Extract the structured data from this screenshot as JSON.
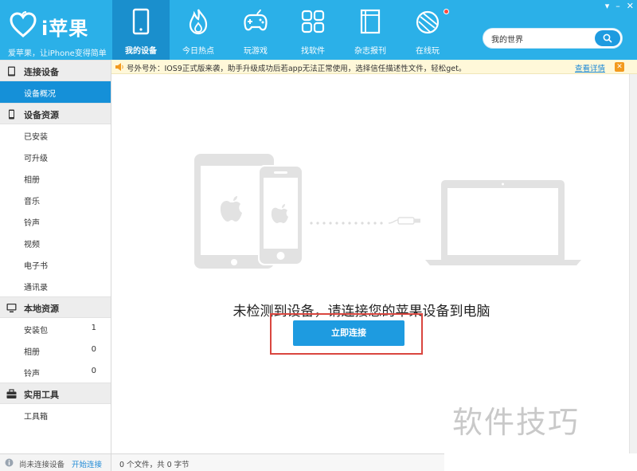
{
  "app": {
    "logo_text": "i苹果",
    "slogan": "爱苹果，让iPhone变得简单"
  },
  "nav": [
    {
      "label": "我的设备",
      "icon": "device-icon",
      "active": true
    },
    {
      "label": "今日热点",
      "icon": "flame-icon"
    },
    {
      "label": "玩游戏",
      "icon": "gamepad-icon"
    },
    {
      "label": "找软件",
      "icon": "apps-grid-icon"
    },
    {
      "label": "杂志报刊",
      "icon": "magazine-icon"
    },
    {
      "label": "在线玩",
      "icon": "online-play-icon",
      "badge": true
    }
  ],
  "window_controls": {
    "menu": "▾",
    "minimize": "–",
    "close": "✕"
  },
  "search": {
    "value": "我的世界"
  },
  "notice": {
    "text": "号外号外：IOS9正式版来袭，助手升级成功后若app无法正常使用，选择信任描述性文件，轻松get。",
    "link": "查看详情",
    "close": "✕"
  },
  "sidebar": {
    "sections": [
      {
        "title": "连接设备",
        "icon": "tablet-icon",
        "items": [
          {
            "label": "设备概况",
            "active": true
          }
        ]
      },
      {
        "title": "设备资源",
        "icon": "phone-icon",
        "items": [
          {
            "label": "已安装"
          },
          {
            "label": "可升级"
          },
          {
            "label": "相册"
          },
          {
            "label": "音乐"
          },
          {
            "label": "铃声"
          },
          {
            "label": "视频"
          },
          {
            "label": "电子书"
          },
          {
            "label": "通讯录"
          }
        ]
      },
      {
        "title": "本地资源",
        "icon": "monitor-icon",
        "items": [
          {
            "label": "安装包",
            "count": "1"
          },
          {
            "label": "相册",
            "count": "0"
          },
          {
            "label": "铃声",
            "count": "0"
          }
        ]
      },
      {
        "title": "实用工具",
        "icon": "toolbox-icon",
        "items": [
          {
            "label": "工具箱"
          }
        ]
      }
    ]
  },
  "status": {
    "left_text": "尚未连接设备",
    "left_link": "开始连接",
    "main_text": "0 个文件，共 0 字节"
  },
  "main": {
    "message": "未检测到设备，请连接您的苹果设备到电脑",
    "connect_button": "立即连接"
  },
  "watermark": "软件技巧",
  "colors": {
    "topbar": "#2bb0e8",
    "active_nav": "#1a8fcd",
    "accent": "#1e9be0",
    "highlight_outline": "#d9463f",
    "illustration": "#e2e2e2"
  }
}
